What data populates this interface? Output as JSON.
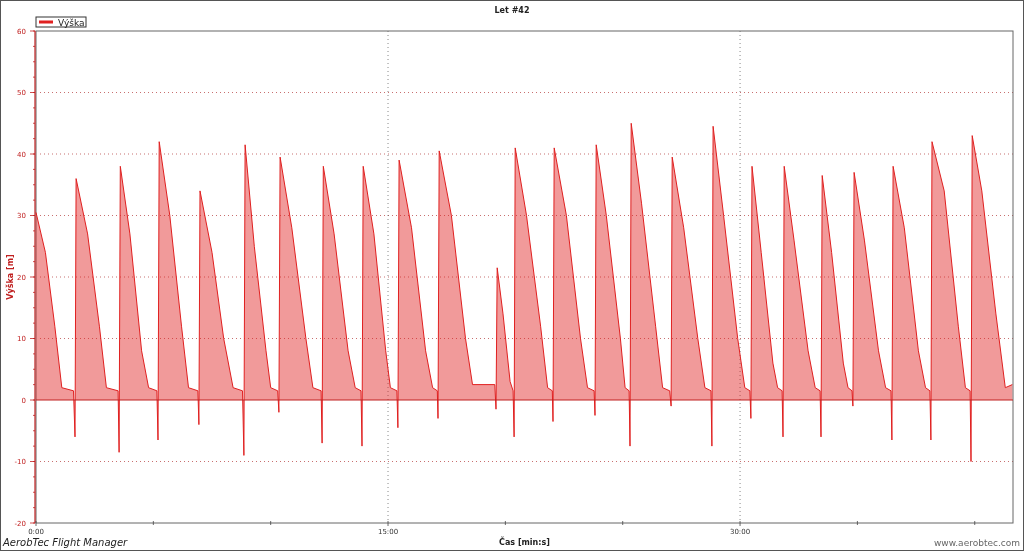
{
  "chart": {
    "footer": "AerobTec Flight Manager",
    "credit": "www.aerobtec.com",
    "chart_data": {
      "type": "area",
      "title": "Let #42",
      "grid": true,
      "ref_lines": [
        {
          "axis": "y",
          "value": 0,
          "color": "#c02020"
        }
      ],
      "xlabel": "Čas [min:s]",
      "ylabel": "Výška [m]",
      "xlim": [
        0,
        41.63
      ],
      "ylim": [
        -20,
        60
      ],
      "xticks": [
        {
          "value": 0,
          "label": "0:00"
        },
        {
          "value": 15,
          "label": "15:00"
        },
        {
          "value": 30,
          "label": "30:00"
        }
      ],
      "yticks": [
        -20,
        -10,
        0,
        10,
        20,
        30,
        40,
        50,
        60
      ],
      "x": [
        0,
        0.4,
        0.8,
        1.1,
        1.6,
        1.66,
        1.71,
        2.2,
        2.7,
        3.0,
        3.5,
        3.54,
        3.59,
        4.0,
        4.5,
        4.8,
        5.15,
        5.2,
        5.25,
        5.7,
        6.2,
        6.5,
        6.9,
        6.94,
        6.99,
        7.5,
        8.0,
        8.4,
        8.8,
        8.86,
        8.91,
        9.3,
        9.8,
        10.0,
        10.3,
        10.35,
        10.4,
        10.9,
        11.5,
        11.8,
        12.15,
        12.19,
        12.24,
        12.7,
        13.3,
        13.6,
        13.85,
        13.89,
        13.94,
        14.4,
        14.9,
        15.1,
        15.38,
        15.42,
        15.47,
        16.0,
        16.6,
        16.9,
        17.1,
        17.13,
        17.18,
        17.7,
        18.3,
        18.6,
        19.55,
        19.6,
        19.65,
        19.9,
        20.2,
        20.33,
        20.37,
        20.42,
        20.9,
        21.5,
        21.8,
        22.0,
        22.03,
        22.08,
        22.6,
        23.2,
        23.5,
        23.78,
        23.82,
        23.87,
        24.3,
        24.9,
        25.1,
        25.27,
        25.31,
        25.36,
        25.8,
        26.4,
        26.7,
        27.0,
        27.06,
        27.11,
        27.6,
        28.2,
        28.5,
        28.76,
        28.8,
        28.85,
        29.3,
        29.9,
        30.2,
        30.42,
        30.46,
        30.51,
        30.9,
        31.4,
        31.6,
        31.79,
        31.83,
        31.88,
        32.3,
        32.9,
        33.2,
        33.41,
        33.45,
        33.5,
        33.9,
        34.4,
        34.6,
        34.77,
        34.81,
        34.86,
        35.3,
        35.9,
        36.2,
        36.43,
        36.47,
        36.52,
        37.0,
        37.6,
        37.9,
        38.09,
        38.13,
        38.18,
        38.7,
        39.3,
        39.6,
        39.8,
        39.84,
        39.89,
        40.3,
        40.9,
        41.3,
        41.6
      ],
      "series": [
        {
          "name": "Výška",
          "color": "#e02020",
          "values": [
            30.5,
            24,
            12,
            2,
            1.5,
            -6,
            36,
            27,
            12,
            2,
            1.5,
            -8.5,
            38,
            27,
            8,
            2,
            1.5,
            -6.5,
            42,
            30,
            12,
            2,
            1.5,
            -4,
            34,
            24,
            10,
            2,
            1.5,
            -9,
            41.5,
            25,
            8,
            2,
            1.5,
            -2,
            39.5,
            28,
            10,
            2,
            1.5,
            -7,
            38,
            27,
            8,
            2,
            1.5,
            -7.5,
            38,
            27,
            8,
            2,
            1.5,
            -4.5,
            39,
            28,
            8,
            2,
            1.5,
            -3,
            40.5,
            30,
            10,
            2.5,
            2.5,
            -1.5,
            21.5,
            14,
            3,
            1.5,
            -6,
            41,
            30,
            12,
            2,
            1.5,
            -3.5,
            41,
            30,
            10,
            2,
            1.5,
            -2.5,
            41.5,
            30,
            10,
            2,
            1.5,
            -7.5,
            45,
            32,
            12,
            2,
            1.5,
            -1,
            39.5,
            28,
            10,
            2,
            1.5,
            -7.5,
            44.5,
            30,
            10,
            2,
            1.5,
            -3,
            38,
            24,
            6,
            2,
            1.5,
            -6,
            38,
            26,
            8,
            2,
            1.5,
            -6,
            36.5,
            24,
            6,
            2,
            1.5,
            -1,
            37,
            26,
            8,
            2,
            1.5,
            -6.5,
            38,
            28,
            8,
            2,
            1.5,
            -6.5,
            42,
            34,
            12,
            2,
            1.5,
            -10,
            43,
            34,
            14,
            2,
            2.5
          ]
        }
      ]
    }
  }
}
